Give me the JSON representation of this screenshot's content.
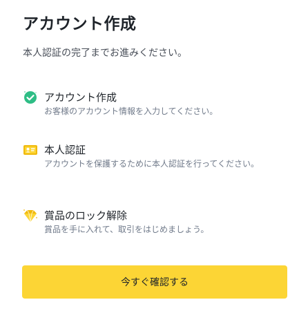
{
  "header": {
    "title": "アカウント作成",
    "subtitle": "本人認証の完了までお進みください。"
  },
  "steps": [
    {
      "icon": "check-circle-icon",
      "title": "アカウント作成",
      "description": "お客様のアカウント情報を入力してください。"
    },
    {
      "icon": "id-card-icon",
      "title": "本人認証",
      "description": "アカウントを保護するために本人認証を行ってください。"
    },
    {
      "icon": "diamond-icon",
      "title": "賞品のロック解除",
      "description": "賞品を手に入れて、取引をはじめましょう。"
    }
  ],
  "cta": {
    "label": "今すぐ確認する"
  },
  "colors": {
    "accent": "#fcd535",
    "success": "#2ebd85",
    "text_primary": "#1e2329",
    "text_secondary": "#707a8a"
  }
}
